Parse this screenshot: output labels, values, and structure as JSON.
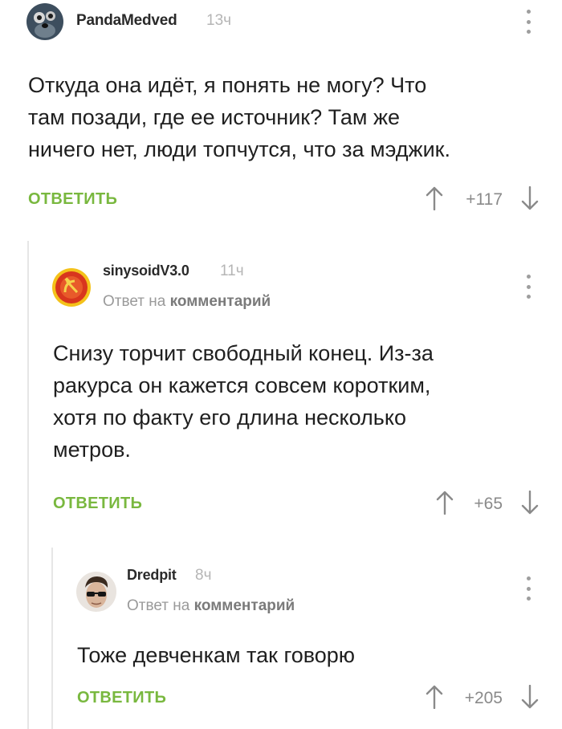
{
  "comments": [
    {
      "username": "PandaMedved",
      "time": "13ч",
      "lines": [
        "Откуда она идёт, я понять не могу? Что",
        "там позади, где ее источник? Там же",
        "ничего нет, люди топчутся, что за мэджик."
      ],
      "reply_label": "ОТВЕТИТЬ",
      "rating": "+117",
      "avatar_icon": "panda-avatar-icon"
    },
    {
      "username": "sinysoidV3.0",
      "time": "11ч",
      "reply_prefix": "Ответ на",
      "reply_target": "комментарий",
      "lines": [
        "Снизу торчит свободный конец. Из-за",
        "ракурса он кажется совсем коротким,",
        "хотя по факту его длина несколько",
        "метров."
      ],
      "reply_label": "ОТВЕТИТЬ",
      "rating": "+65",
      "avatar_icon": "hammer-sickle-emblem-icon"
    },
    {
      "username": "Dredpit",
      "time": "8ч",
      "reply_prefix": "Ответ на",
      "reply_target": "комментарий",
      "lines": [
        "Тоже девченкам так говорю"
      ],
      "reply_label": "ОТВЕТИТЬ",
      "rating": "+205",
      "avatar_icon": "man-sunglasses-avatar-icon"
    }
  ],
  "colors": {
    "reply_green": "#79b83f",
    "meta_gray": "#9a9a9a",
    "thread_line": "#e6e6e6"
  }
}
